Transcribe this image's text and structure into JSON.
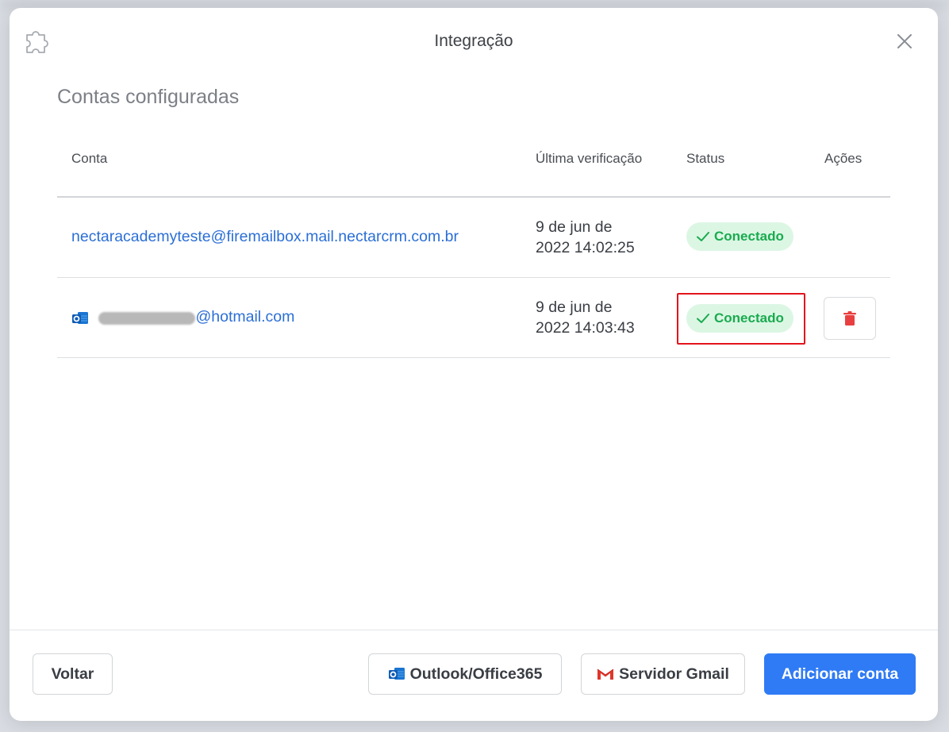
{
  "modal": {
    "title": "Integração",
    "section_title": "Contas configuradas"
  },
  "table": {
    "headers": {
      "account": "Conta",
      "last_check": "Última verificação",
      "status": "Status",
      "actions": "Ações"
    },
    "rows": [
      {
        "account": "nectaracademyteste@firemailbox.mail.nectarcrm.com.br",
        "date_line1": "9 de jun de",
        "date_line2": "2022 14:02:25",
        "status": "Conectado",
        "icon": "none"
      },
      {
        "account_visible_suffix": "@hotmail.com",
        "date_line1": "9 de jun de",
        "date_line2": "2022 14:03:43",
        "status": "Conectado",
        "icon": "outlook-icon",
        "highlighted": true
      }
    ]
  },
  "footer": {
    "back_label": "Voltar",
    "outlook_label": "Outlook/Office365",
    "gmail_label": "Servidor Gmail",
    "add_label": "Adicionar conta"
  },
  "colors": {
    "primary": "#2f7bf5",
    "link": "#2b6fd6",
    "success_text": "#1aab4f",
    "success_bg": "#dcf6e4",
    "danger": "#e84040",
    "highlight": "#e3141c"
  }
}
